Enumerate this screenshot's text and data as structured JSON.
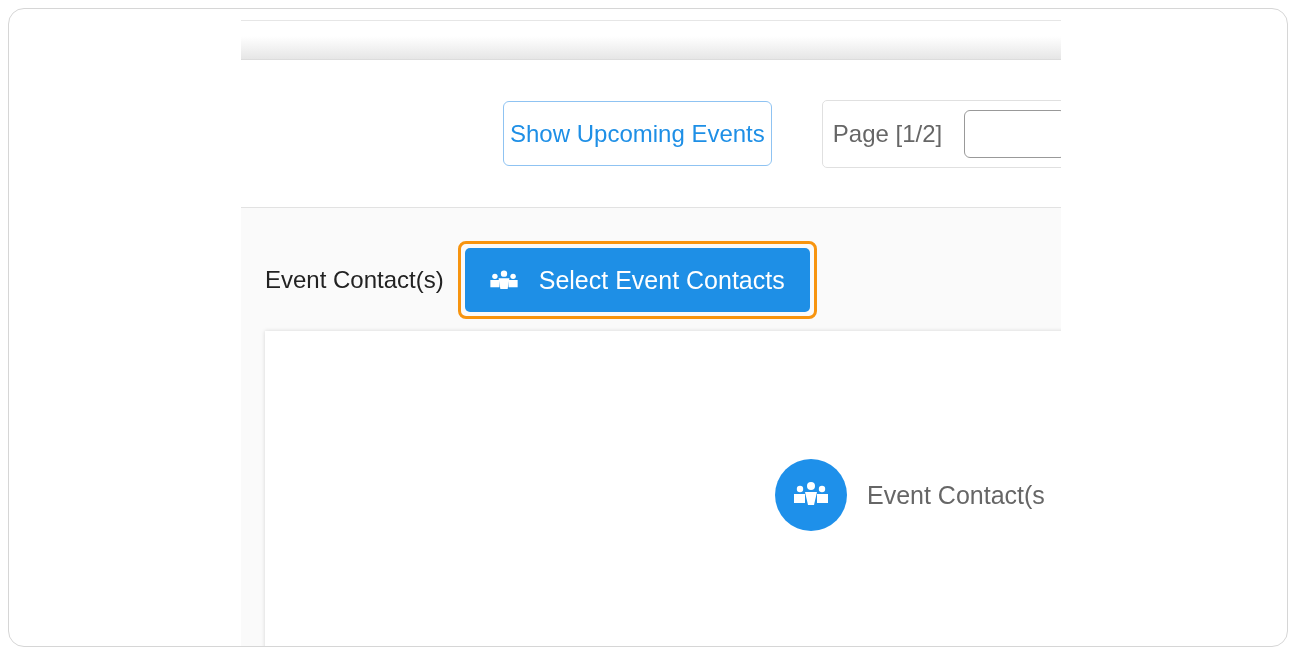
{
  "toolbar": {
    "upcoming_button": "Show Upcoming Events",
    "page_label": "Page [1/2]"
  },
  "contacts": {
    "label": "Event Contact(s)",
    "select_button": {
      "label": "Select Event Contacts",
      "highlighted": true
    },
    "panel_caption": "Event Contact(s"
  }
}
